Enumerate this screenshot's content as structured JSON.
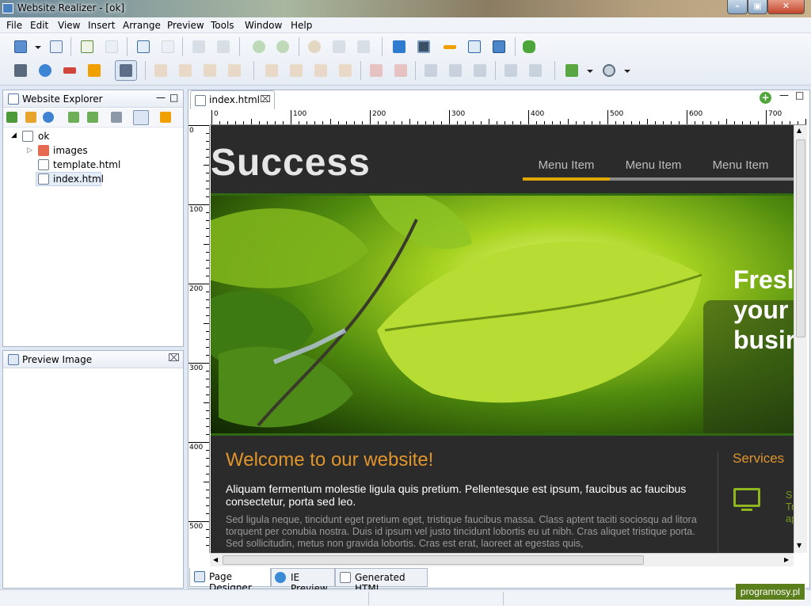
{
  "window": {
    "title": "Website Realizer - [ok]"
  },
  "menu": {
    "items": [
      "File",
      "Edit",
      "View",
      "Insert",
      "Arrange",
      "Preview",
      "Tools",
      "Window",
      "Help"
    ]
  },
  "toolbar": {
    "row1": [
      "new-page",
      "open",
      "new-site",
      "blank-page",
      "print-preview",
      "page-setup",
      "save",
      "save-all",
      "undo",
      "redo",
      "cut",
      "copy",
      "paste",
      "text-tool",
      "form-tool",
      "line-tool",
      "table-tool",
      "image-tool",
      "users-tool"
    ],
    "row2": [
      "grid",
      "move",
      "align-center",
      "snap",
      "ruler-guide",
      "back",
      "backward",
      "forward",
      "front",
      "align-left",
      "align-center-v",
      "align-top",
      "align-bottom",
      "space-h",
      "space-v",
      "fit",
      "same-width",
      "same-height",
      "group",
      "ungroup",
      "publish",
      "zoom"
    ]
  },
  "explorer": {
    "title": "Website Explorer",
    "root": "ok",
    "items": [
      "images",
      "template.html",
      "index.html"
    ]
  },
  "preview_panel": {
    "title": "Preview Image"
  },
  "editor": {
    "tab_label": "index.html",
    "ruler_h": [
      "0",
      "100",
      "200",
      "300",
      "400",
      "500",
      "600",
      "700"
    ],
    "ruler_v": [
      "0",
      "100",
      "200",
      "300",
      "400",
      "500"
    ]
  },
  "site": {
    "logo": "Success",
    "nav": [
      "Menu Item",
      "Menu Item",
      "Menu Item"
    ],
    "hero_lines": [
      "Fresl",
      "your",
      "busir"
    ],
    "welcome": "Welcome to our website!",
    "lead": "Aliquam fermentum molestie ligula quis pretium. Pellentesque est ipsum, faucibus ac faucibus consectetur, porta sed leo.",
    "body": "Sed ligula neque, tincidunt eget pretium eget, tristique faucibus massa. Class aptent taciti sociosqu ad litora torquent per conubia nostra. Duis id ipsum vel justo tincidunt lobortis eu ut nibh. Cras aliquet tristique porta. Sed sollicitudin, metus non gravida lobortis. Cras est erat, laoreet at egestas quis,",
    "services_title": "Services",
    "services_text": "S p Tr ap"
  },
  "bottom_tabs": [
    "Page Designer",
    "IE Preview",
    "Generated HTML"
  ],
  "watermark": "programosy.pl",
  "colors": {
    "accent_orange": "#e0952c",
    "nav_active": "#e0a800",
    "hero_green": "#a7d321"
  }
}
